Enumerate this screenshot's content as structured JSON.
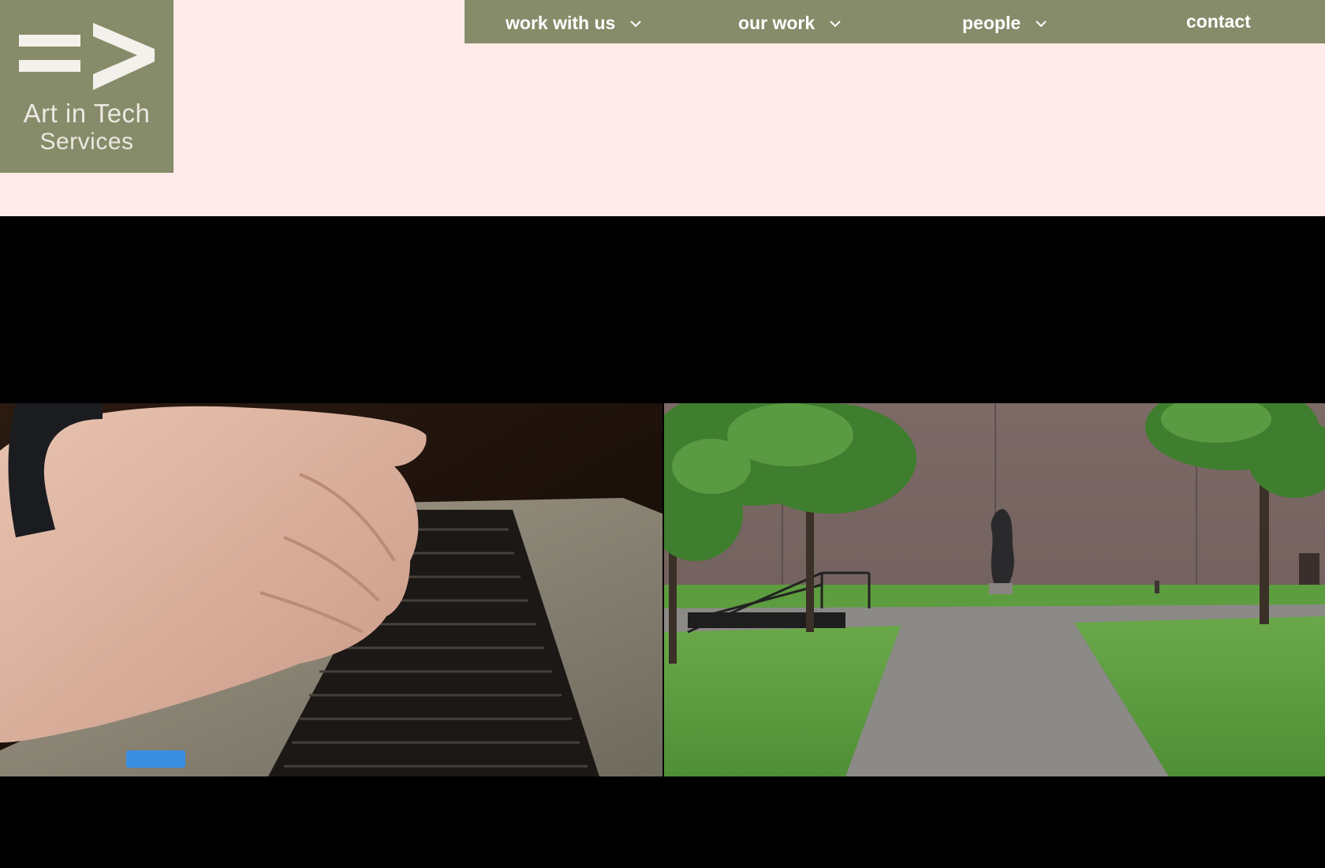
{
  "logo": {
    "line1": "Art in Tech",
    "line2": "Services",
    "background": "#868b6a",
    "icon": "equals-arrow-icon"
  },
  "nav": {
    "background": "#868b6a",
    "items": [
      {
        "label": "work with us",
        "has_dropdown": true,
        "icon": "chevron-down-icon"
      },
      {
        "label": "our work",
        "has_dropdown": true,
        "icon": "chevron-down-icon"
      },
      {
        "label": "people",
        "has_dropdown": true,
        "icon": "chevron-down-icon"
      },
      {
        "label": "contact",
        "has_dropdown": false
      }
    ]
  },
  "colors": {
    "page_background": "#ffebea",
    "hero_background": "#000000",
    "accent": "#868b6a"
  },
  "hero": {
    "images": [
      {
        "name": "hands-typing-on-laptop-image"
      },
      {
        "name": "museum-courtyard-sculpture-image"
      }
    ]
  }
}
